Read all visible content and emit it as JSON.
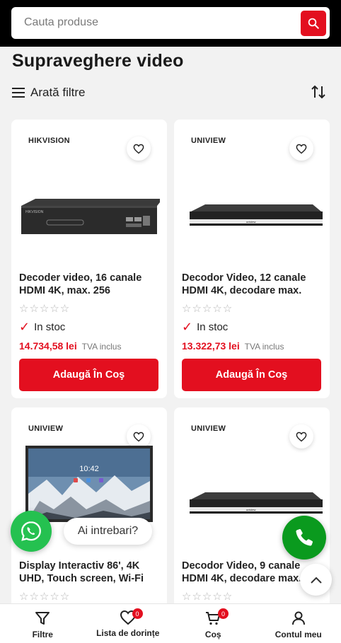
{
  "search": {
    "placeholder": "Cauta produse"
  },
  "page": {
    "title": "Supraveghere video"
  },
  "filters": {
    "label": "Arată filtre"
  },
  "products": [
    {
      "brand": "HIKVISION",
      "name": "Decoder video, 16 canale HDMI 4K, max. 256",
      "stars": "☆☆☆☆☆",
      "rating": 0,
      "stock": "In stoc",
      "price": "14.734,58 lei",
      "vat": "TVA inclus",
      "cta": "Adaugă În Coş"
    },
    {
      "brand": "UNIVIEW",
      "name": "Decodor Video, 12 canale HDMI 4K, decodare max.",
      "stars": "☆☆☆☆☆",
      "rating": 0,
      "stock": "In stoc",
      "price": "13.322,73 lei",
      "vat": "TVA inclus",
      "cta": "Adaugă În Coş"
    },
    {
      "brand": "UNIVIEW",
      "name": "Display Interactiv 86', 4K UHD, Touch screen, Wi-Fi",
      "stars": "☆☆☆☆☆",
      "rating": 0,
      "screen_time": "10:42"
    },
    {
      "brand": "UNIVIEW",
      "name": "Decodor Video, 9 canale HDMI 4K, decodare max.",
      "stars": "☆☆☆☆☆",
      "rating": 0
    }
  ],
  "whatsapp": {
    "bubble": "Ai intrebari?"
  },
  "bottom_nav": [
    {
      "label": "Filtre",
      "icon": "filter-icon"
    },
    {
      "label": "Lista de dorințe",
      "icon": "heart-icon",
      "badge": "0"
    },
    {
      "label": "Coș",
      "icon": "cart-icon",
      "badge": "0"
    },
    {
      "label": "Contul meu",
      "icon": "user-icon"
    }
  ],
  "colors": {
    "accent": "#e30f1f",
    "whatsapp": "#25c150",
    "call": "#0a9a1e",
    "topbar": "#000000"
  }
}
